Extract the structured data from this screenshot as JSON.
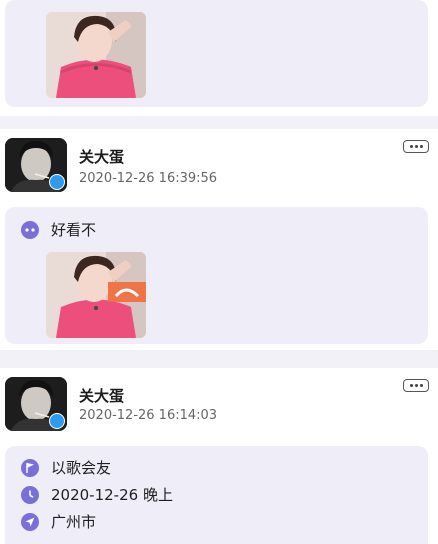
{
  "feed": {
    "posts": [
      {
        "username": "关大蛋",
        "timestamp": "2020-12-26 16:39:56",
        "comment": "好看不"
      },
      {
        "username": "关大蛋",
        "timestamp": "2020-12-26 16:14:03",
        "activity": {
          "type_label": "以歌会友",
          "time_label": "2020-12-26 晚上",
          "location_label": "广州市"
        }
      }
    ]
  },
  "colors": {
    "accent": "#7a6fd9",
    "panel": "#efedf8",
    "verified_badge": "#2f9bf0"
  },
  "icons": {
    "comment": "chat-bubble-icon",
    "activity_type": "flag-icon",
    "activity_time": "clock-icon",
    "activity_location": "location-arrow-icon",
    "more": "more-dots-icon"
  }
}
